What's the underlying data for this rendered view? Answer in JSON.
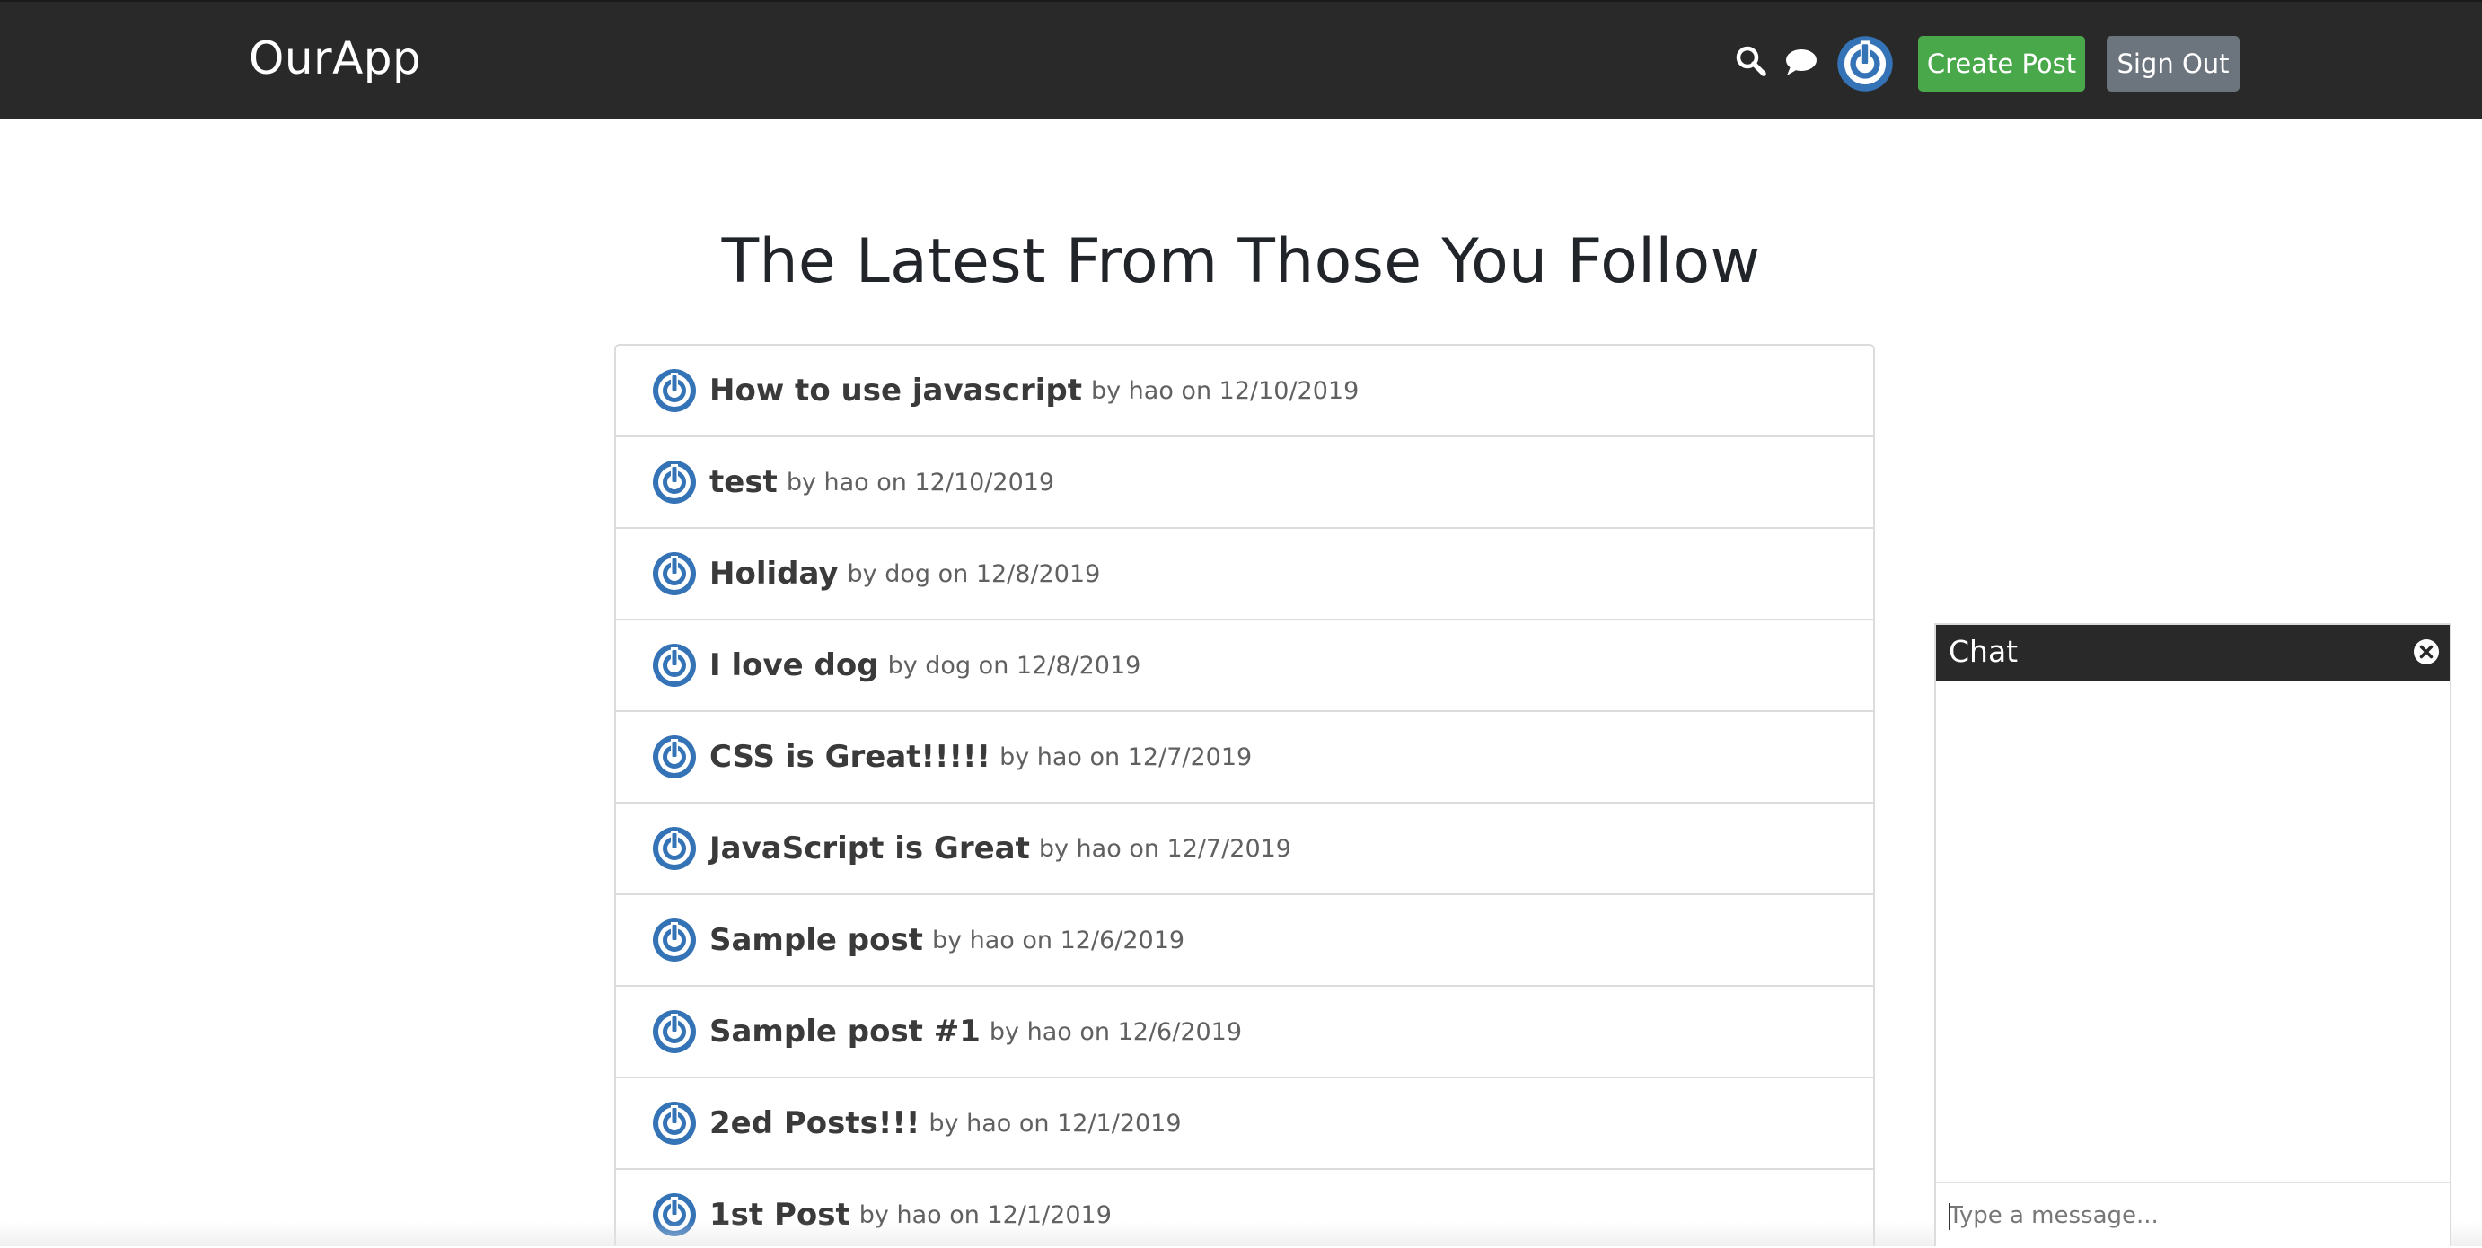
{
  "header": {
    "brand": "OurApp",
    "icons": {
      "search": "search-icon",
      "chat": "chat-bubble-icon",
      "avatar": "avatar-power-icon"
    },
    "create_post_label": "Create Post",
    "sign_out_label": "Sign Out",
    "bg_color": "#292929"
  },
  "main": {
    "title": "The Latest From Those You Follow",
    "posts": [
      {
        "title": "How to use javascript",
        "meta": "by hao on 12/10/2019"
      },
      {
        "title": "test",
        "meta": "by hao on 12/10/2019"
      },
      {
        "title": "Holiday",
        "meta": "by dog on 12/8/2019"
      },
      {
        "title": "I love dog",
        "meta": "by dog on 12/8/2019"
      },
      {
        "title": "CSS is Great!!!!!",
        "meta": "by hao on 12/7/2019"
      },
      {
        "title": "JavaScript is Great",
        "meta": "by hao on 12/7/2019"
      },
      {
        "title": "Sample post",
        "meta": "by hao on 12/6/2019"
      },
      {
        "title": "Sample post #1",
        "meta": "by hao on 12/6/2019"
      },
      {
        "title": "2ed Posts!!!",
        "meta": "by hao on 12/1/2019"
      },
      {
        "title": "1st Post",
        "meta": "by hao on 12/1/2019"
      }
    ]
  },
  "chat": {
    "title": "Chat",
    "close_icon": "close-circle-icon",
    "input_placeholder": "Type a message..."
  },
  "colors": {
    "accent_green": "#49a84a",
    "secondary_gray": "#6c757d",
    "avatar_blue": "#3573b7"
  }
}
